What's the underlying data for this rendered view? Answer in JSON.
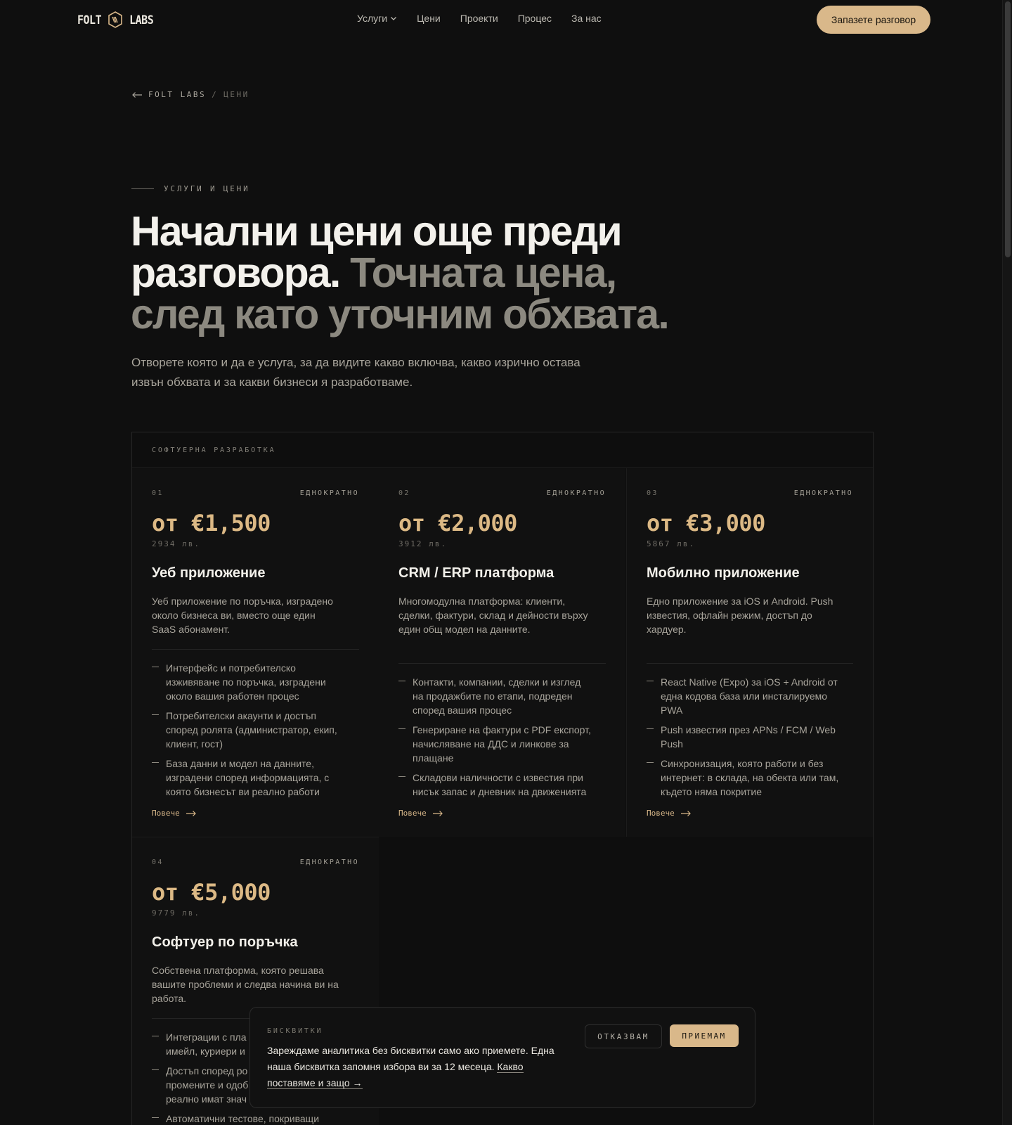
{
  "header": {
    "logo_left": "FOLT",
    "logo_right": "LABS",
    "nav": [
      {
        "label": "Услуги",
        "has_dropdown": true
      },
      {
        "label": "Цени"
      },
      {
        "label": "Проекти"
      },
      {
        "label": "Процес"
      },
      {
        "label": "За нас"
      }
    ],
    "cta_label": "Запазете разговор"
  },
  "breadcrumb": {
    "home": "FOLT LABS",
    "separator": "/",
    "current": "ЦЕНИ"
  },
  "hero": {
    "eyebrow": "УСЛУГИ И ЦЕНИ",
    "headline_strong": "Начални цени още преди разговора.",
    "headline_muted": "Точната цена, след като уточним обхвата.",
    "lede": "Отворете която и да е услуга, за да видите какво включва, какво изрично остава извън обхвата и за какви бизнеси я разработваме."
  },
  "pricing": {
    "section_label": "СОФТУЕРНА РАЗРАБОТКА",
    "cards": [
      {
        "num": "01",
        "type": "ЕДНОКРАТНО",
        "price": "от €1,500",
        "price_bgn": "2934 лв.",
        "title": "Уеб приложение",
        "desc": "Уеб приложение по поръчка, изградено около бизнеса ви, вместо още един SaaS абонамент.",
        "features": [
          "Интерфейс и потребителско изживяване по поръчка, изградени около вашия работен процес",
          "Потребителски акаунти и достъп според ролята (администратор, екип, клиент, гост)",
          "База данни и модел на данните, изградени според информацията, с която бизнесът ви реално работи"
        ],
        "more": "Повече"
      },
      {
        "num": "02",
        "type": "ЕДНОКРАТНО",
        "price": "от €2,000",
        "price_bgn": "3912 лв.",
        "title": "CRM / ERP платформа",
        "desc": "Многомодулна платформа: клиенти, сделки, фактури, склад и дейности върху един общ модел на данните.",
        "features": [
          "Контакти, компании, сделки и изглед на продажбите по етапи, подреден според вашия процес",
          "Генериране на фактури с PDF експорт, начисляване на ДДС и линкове за плащане",
          "Складови наличности с известия при нисък запас и дневник на движенията"
        ],
        "more": "Повече"
      },
      {
        "num": "03",
        "type": "ЕДНОКРАТНО",
        "price": "от €3,000",
        "price_bgn": "5867 лв.",
        "title": "Мобилно приложение",
        "desc": "Едно приложение за iOS и Android. Push известия, офлайн режим, достъп до хардуер.",
        "features": [
          "React Native (Expo) за iOS + Android от една кодова база или инсталируемо PWA",
          "Push известия през APNs / FCM / Web Push",
          "Синхронизация, която работи и без интернет: в склада, на обекта или там, където няма покритие"
        ],
        "more": "Повече"
      },
      {
        "num": "04",
        "type": "ЕДНОКРАТНО",
        "price": "от €5,000",
        "price_bgn": "9779 лв.",
        "title": "Софтуер по поръчка",
        "desc": "Собствена платформа, която решава вашите проблеми и следва начина ви на работа.",
        "features": [
          "Интеграции с пла имейл, куриери и",
          "Достъп според ро промените и одоб реално имат знач",
          "Автоматични тестове, покриващи"
        ],
        "more": ""
      }
    ]
  },
  "cookie": {
    "label": "БИСКВИТКИ",
    "text": "Зареждаме аналитика без бисквитки само ако приемете. Една наша бисквитка запомня избора ви за 12 месеца.",
    "link": "Какво поставяме и защо →",
    "deny": "ОТКАЗВАМ",
    "accept": "ПРИЕМАМ"
  },
  "colors": {
    "accent": "#d9b88a",
    "background": "#0f0f0f",
    "text": "#eceae4",
    "muted": "#8c8980"
  }
}
